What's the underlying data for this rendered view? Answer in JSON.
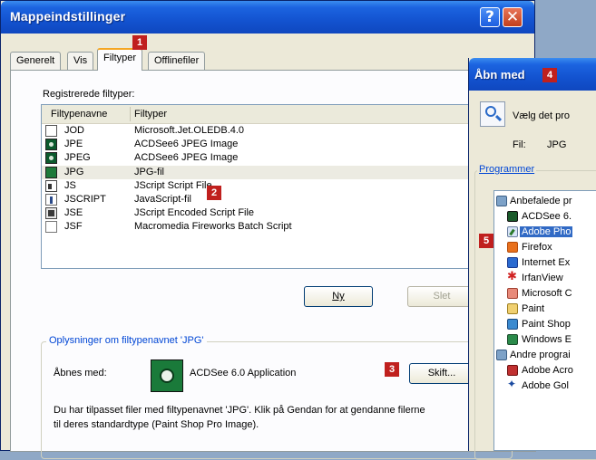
{
  "folder_options": {
    "title": "Mappeindstillinger",
    "help_label": "?",
    "close_label": "✕",
    "tabs": [
      {
        "label": "Generelt"
      },
      {
        "label": "Vis"
      },
      {
        "label": "Filtyper",
        "active": true
      },
      {
        "label": "Offlinefiler"
      }
    ],
    "registered_label": "Registrerede filtyper:",
    "columns": [
      "Filtypenavne",
      "Filtyper"
    ],
    "file_types": [
      {
        "ext": "JOD",
        "type": "Microsoft.Jet.OLEDB.4.0",
        "icon": "document-icon"
      },
      {
        "ext": "JPE",
        "type": "ACDSee6 JPEG Image",
        "icon": "acdsee-icon"
      },
      {
        "ext": "JPEG",
        "type": "ACDSee6 JPEG Image",
        "icon": "acdsee-icon"
      },
      {
        "ext": "JPG",
        "type": "JPG-fil",
        "icon": "jpg-icon",
        "selected": true
      },
      {
        "ext": "JS",
        "type": "JScript Script File",
        "icon": "js-icon"
      },
      {
        "ext": "JSCRIPT",
        "type": "JavaScript-fil",
        "icon": "script-icon"
      },
      {
        "ext": "JSE",
        "type": "JScript Encoded Script File",
        "icon": "jse-icon"
      },
      {
        "ext": "JSF",
        "type": "Macromedia Fireworks Batch Script",
        "icon": "fireworks-icon"
      }
    ],
    "new_button": "Ny",
    "delete_button": "Slet",
    "details_title": "Oplysninger om filtypenavnet 'JPG'",
    "opens_with_label": "Åbnes med:",
    "opens_with_app": "ACDSee 6.0 Application",
    "change_button": "Skift...",
    "info_text": "Du har tilpasset filer med filtypenavnet 'JPG'. Klik på Gendan for at gendanne filerne til deres standardtype (Paint Shop Pro Image)."
  },
  "open_with": {
    "title": "Åbn med",
    "choose_text": "Vælg det pro",
    "file_label": "Fil:",
    "file_value": "JPG",
    "programs_label": "Programmer",
    "tree": [
      {
        "label": "Anbefalede pr",
        "icon": "folder-icon",
        "level": 0
      },
      {
        "label": "ACDSee 6.",
        "icon": "acdsee-icon",
        "level": 1
      },
      {
        "label": "Adobe Pho",
        "icon": "adobe-photoshop-icon",
        "level": 1,
        "selected": true
      },
      {
        "label": "Firefox",
        "icon": "firefox-icon",
        "level": 1
      },
      {
        "label": "Internet Ex",
        "icon": "internet-explorer-icon",
        "level": 1
      },
      {
        "label": "IrfanView",
        "icon": "irfanview-icon",
        "level": 1
      },
      {
        "label": "Microsoft C",
        "icon": "office-icon",
        "level": 1
      },
      {
        "label": "Paint",
        "icon": "paint-icon",
        "level": 1
      },
      {
        "label": "Paint Shop",
        "icon": "paint-shop-icon",
        "level": 1
      },
      {
        "label": "Windows E",
        "icon": "windows-picture-icon",
        "level": 1
      },
      {
        "label": "Andre prograi",
        "icon": "folder-icon",
        "level": 0
      },
      {
        "label": "Adobe Acro",
        "icon": "acrobat-icon",
        "level": 1
      },
      {
        "label": "Adobe Gol",
        "icon": "golive-icon",
        "level": 1
      }
    ]
  },
  "callouts": [
    "1",
    "2",
    "3",
    "4",
    "5"
  ],
  "colors": {
    "title_bar": "#1353d0",
    "callout_badge": "#c0201e",
    "selection": "#316ac5",
    "link_text": "#0046d5"
  }
}
